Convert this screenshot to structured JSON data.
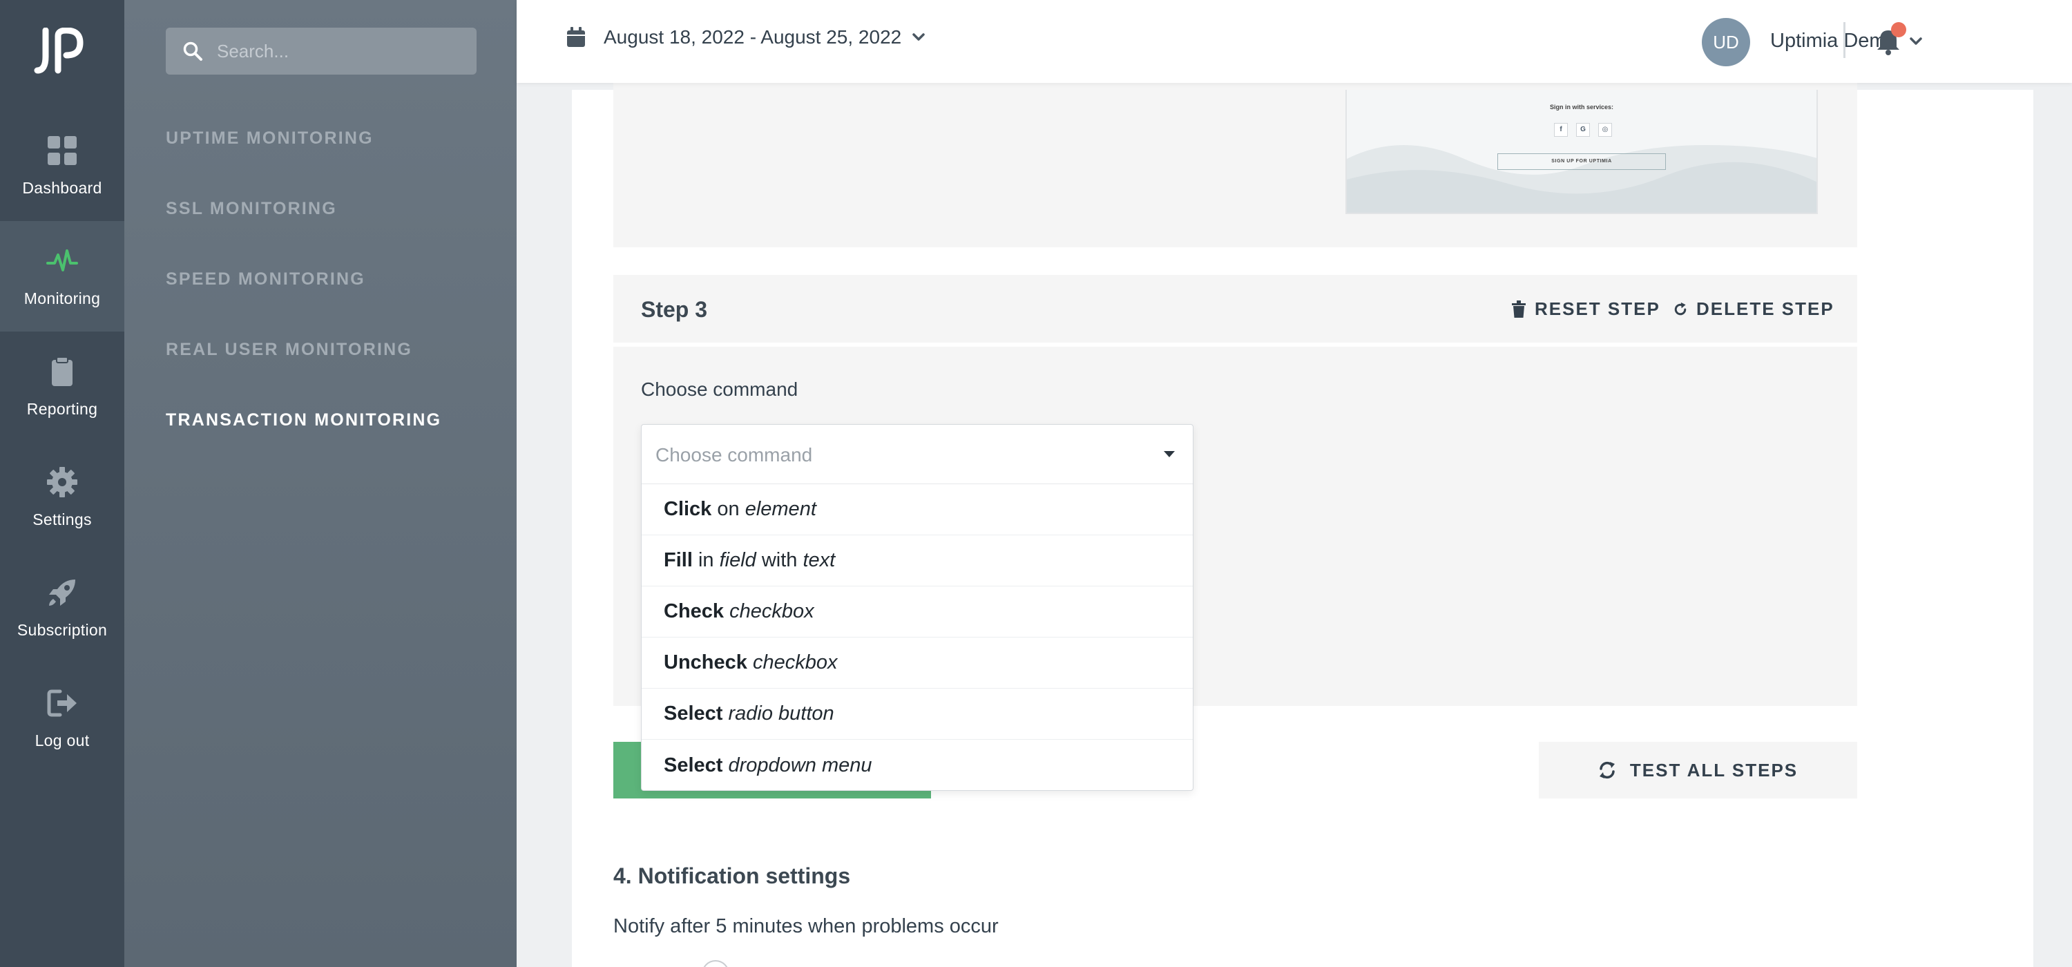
{
  "rail": {
    "items": [
      {
        "label": "Dashboard",
        "icon": "grid-icon"
      },
      {
        "label": "Monitoring",
        "icon": "pulse-icon"
      },
      {
        "label": "Reporting",
        "icon": "clipboard-icon"
      },
      {
        "label": "Settings",
        "icon": "gear-icon"
      },
      {
        "label": "Subscription",
        "icon": "rocket-icon"
      },
      {
        "label": "Log out",
        "icon": "logout-icon"
      }
    ],
    "active_color": "#4bc16e"
  },
  "submenu": {
    "search_placeholder": "Search...",
    "items": [
      {
        "label": "UPTIME MONITORING"
      },
      {
        "label": "SSL MONITORING"
      },
      {
        "label": "SPEED MONITORING"
      },
      {
        "label": "REAL USER MONITORING"
      },
      {
        "label": "TRANSACTION MONITORING"
      }
    ]
  },
  "header": {
    "date_range": "August 18, 2022 - August 25, 2022",
    "avatar_initials": "UD",
    "user_name": "Uptimia Demo"
  },
  "thumbnail": {
    "title": "Sign in with services:",
    "social": [
      "f",
      "G",
      "◎"
    ],
    "button": "SIGN UP FOR UPTIMIA"
  },
  "step3": {
    "title": "Step 3",
    "reset_label": "RESET STEP",
    "delete_label": "DELETE STEP",
    "choose_label": "Choose command"
  },
  "dropdown": {
    "placeholder": "Choose command",
    "options": [
      {
        "verb": "Click",
        "p1": " on ",
        "t1": "element",
        "p2": "",
        "t2": ""
      },
      {
        "verb": "Fill",
        "p1": " in ",
        "t1": "field",
        "p2": " with ",
        "t2": "text"
      },
      {
        "verb": "Check",
        "p1": " ",
        "t1": "checkbox",
        "p2": "",
        "t2": ""
      },
      {
        "verb": "Uncheck",
        "p1": " ",
        "t1": "checkbox",
        "p2": "",
        "t2": ""
      },
      {
        "verb": "Select",
        "p1": " ",
        "t1": "radio button",
        "p2": "",
        "t2": ""
      },
      {
        "verb": "Select",
        "p1": " ",
        "t1": "dropdown menu",
        "p2": "",
        "t2": ""
      }
    ]
  },
  "actions": {
    "test_all_label": "TEST ALL STEPS"
  },
  "notifications": {
    "title": "4. Notification settings",
    "text": "Notify after 5 minutes when problems occur"
  }
}
